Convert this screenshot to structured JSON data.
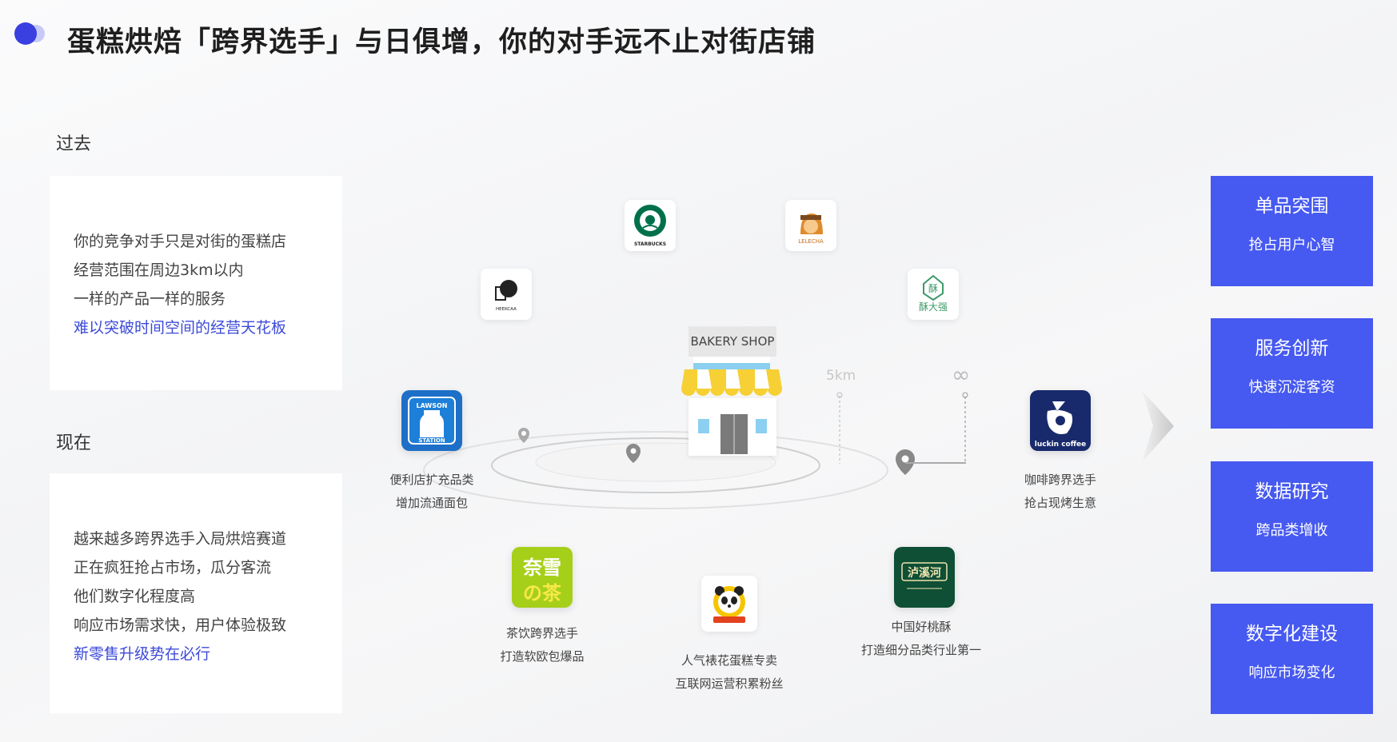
{
  "title": "蛋糕烘焙「跨界选手」与日俱增，你的对手远不止对街店铺",
  "past": {
    "label": "过去",
    "lines": [
      "你的竞争对手只是对街的蛋糕店",
      "经营范围在周边3km以内",
      "一样的产品一样的服务"
    ],
    "highlight": "难以突破时间空间的经营天花板"
  },
  "now": {
    "label": "现在",
    "lines": [
      "越来越多跨界选手入局烘焙赛道",
      "正在疯狂抢占市场，瓜分客流",
      "他们数字化程度高",
      "响应市场需求快，用户体验极致"
    ],
    "highlight": "新零售升级势在必行"
  },
  "diagram": {
    "shop_sign": "BAKERY SHOP",
    "distance_label": "5km",
    "infinity_label": "∞",
    "logos": {
      "starbucks": "STARBUCKS",
      "lelecha": "LELECHA",
      "heekcaa": "HEEKCAA",
      "sudaqiang": "酥大强",
      "lawson_top": "LAWSON",
      "lawson_bottom": "STATION",
      "luckin": "luckin coffee",
      "naixue_1": "奈雪",
      "naixue_2": "の茶",
      "luxihe": "泸溪河"
    },
    "captions": {
      "lawson": [
        "便利店扩充品类",
        "增加流通面包"
      ],
      "luckin": [
        "咖啡跨界选手",
        "抢占现烤生意"
      ],
      "naixue": [
        "茶饮跨界选手",
        "打造软欧包爆品"
      ],
      "panda": [
        "人气裱花蛋糕专卖",
        "互联网运营积累粉丝"
      ],
      "luxihe": [
        "中国好桃酥",
        "打造细分品类行业第一"
      ]
    }
  },
  "cards": [
    {
      "title": "单品突围",
      "sub": "抢占用户心智"
    },
    {
      "title": "服务创新",
      "sub": "快速沉淀客资"
    },
    {
      "title": "数据研究",
      "sub": "跨品类增收"
    },
    {
      "title": "数字化建设",
      "sub": "响应市场变化"
    }
  ],
  "colors": {
    "accent": "#4659f0",
    "highlight_text": "#3c4ad8",
    "title_dot": "#3a3fe0"
  }
}
